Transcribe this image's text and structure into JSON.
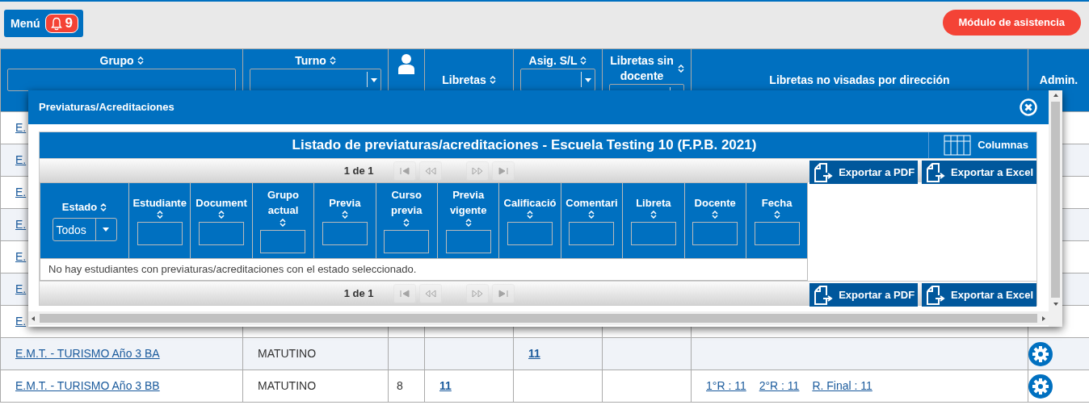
{
  "top_bar": {
    "menu_label": "Menú",
    "notifications": "9",
    "attendance_button": "Módulo de asistencia"
  },
  "groups_table": {
    "columns": [
      {
        "kind": "text-filter",
        "label": "Grupo",
        "sortable": true
      },
      {
        "kind": "select-filter",
        "label": "Turno",
        "sortable": true
      },
      {
        "kind": "person-icon"
      },
      {
        "kind": "plain",
        "label": "Libretas",
        "sortable": true
      },
      {
        "kind": "select-filter",
        "label": "Asig. S/L",
        "sortable": true
      },
      {
        "kind": "select-filter",
        "label": "Libretas sin docente",
        "sortable": true
      },
      {
        "kind": "plain",
        "label": "Libretas no visadas por dirección",
        "sortable": false
      },
      {
        "kind": "plain",
        "label": "Admin.",
        "sortable": false
      }
    ],
    "rows": [
      {
        "group": "E."
      },
      {
        "group": "E."
      },
      {
        "group": "E."
      },
      {
        "group": "E."
      },
      {
        "group": "E."
      },
      {
        "group": "E."
      },
      {
        "group": "E."
      },
      {
        "group": "E.M.T. - TURISMO Año 3 BA",
        "turno": "MATUTINO",
        "asig": "11",
        "settings": true
      },
      {
        "group": "E.M.T. - TURISMO Año 3 BB",
        "turno": "MATUTINO",
        "students": "8",
        "libretas": "11",
        "reports": [
          "1°R : 11",
          "2°R : 11",
          "R. Final : 11"
        ],
        "settings": true
      }
    ]
  },
  "dialog": {
    "title": "Previaturas/Acreditaciones",
    "grid": {
      "caption": "Listado de previaturas/acreditaciones - Escuela Testing 10 (F.P.B. 2021)",
      "columns_button": "Columnas",
      "pager_top": {
        "text": "1 de 1",
        "nav_disabled": true
      },
      "export_top": [
        "Exportar a PDF",
        "Exportar a Excel"
      ],
      "columns": [
        {
          "label": "Estado",
          "kind": "select",
          "value": "Todos"
        },
        {
          "label": "Estudiante",
          "kind": "text"
        },
        {
          "label": "Document",
          "kind": "text"
        },
        {
          "label": "Grupo actual",
          "kind": "text"
        },
        {
          "label": "Previa",
          "kind": "text"
        },
        {
          "label": "Curso previa",
          "kind": "text"
        },
        {
          "label": "Previa vigente",
          "kind": "text"
        },
        {
          "label": "Calificació",
          "kind": "text"
        },
        {
          "label": "Comentari",
          "kind": "text"
        },
        {
          "label": "Libreta",
          "kind": "text"
        },
        {
          "label": "Docente",
          "kind": "text"
        },
        {
          "label": "Fecha",
          "kind": "text"
        }
      ],
      "empty_message": "No hay estudiantes con previaturas/acreditaciones con el estado seleccionado.",
      "pager_bottom": {
        "text": "1 de 1",
        "nav_disabled": true
      },
      "export_bottom": [
        "Exportar a PDF",
        "Exportar a Excel"
      ]
    }
  }
}
